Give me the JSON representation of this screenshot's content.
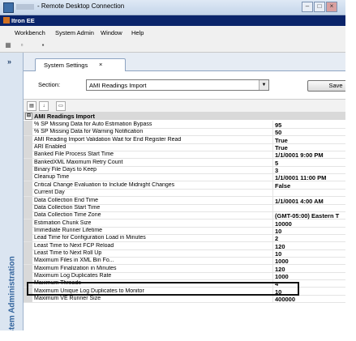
{
  "window": {
    "title": "- Remote Desktop Connection",
    "app_title": "Itron EE"
  },
  "menu": [
    "Workbench",
    "System Admin",
    "Window",
    "Help"
  ],
  "left_panel": {
    "expand_glyph": "»",
    "label": "System Administration"
  },
  "tab": {
    "label": "System Settings",
    "close": "×"
  },
  "section": {
    "label": "Section:",
    "value": "AMI Readings Import",
    "save_label": "Save"
  },
  "category": {
    "toggle": "⊟",
    "name": "AMI Readings Import"
  },
  "rows": [
    {
      "name": "% SP Missing Data for Auto Estimation Bypass",
      "value": "95"
    },
    {
      "name": "% SP Missing Data for Warning Notification",
      "value": "50"
    },
    {
      "name": "AMI Reading Import Validation Wait for End Register Read",
      "value": "True"
    },
    {
      "name": "ARI Enabled",
      "value": "True"
    },
    {
      "name": "Banked File Process Start Time",
      "value": "1/1/0001 9:00 PM"
    },
    {
      "name": "BankedXML Maximum Retry Count",
      "value": "5"
    },
    {
      "name": "Binary File Days to Keep",
      "value": "3"
    },
    {
      "name": "Cleanup Time",
      "value": "1/1/0001 11:00 PM"
    },
    {
      "name": "Critical Change Evaluation to Include Midnight Changes",
      "value": "False"
    },
    {
      "name": "Current Day",
      "value": ""
    },
    {
      "name": "Data Collection End Time",
      "value": "1/1/0001 4:00 AM"
    },
    {
      "name": "Data Collection Start Time",
      "value": ""
    },
    {
      "name": "Data Collection Time Zone",
      "value": "(GMT-05:00) Eastern T"
    },
    {
      "name": "Estimation Chunk Size",
      "value": "10000"
    },
    {
      "name": "Immediate Runner Lifetime",
      "value": "10"
    },
    {
      "name": "Lead Time for Configuration Load in Minutes",
      "value": "2"
    },
    {
      "name": "Least Time to Next FCP Reload",
      "value": "120"
    },
    {
      "name": "Least Time to Next Roll Up",
      "value": "10"
    },
    {
      "name": "Maximum Files in XML Bin Fo...",
      "value": "1000"
    },
    {
      "name": "Maximum Finalization in Minutes",
      "value": "120"
    },
    {
      "name": "Maximum Log Duplicates Rate",
      "value": "1000"
    },
    {
      "name": "Maximum Threads",
      "value": "4"
    },
    {
      "name": "Maximum Unique Log Duplicates to Monitor",
      "value": "10"
    },
    {
      "name": "Maximum VE Runner Size",
      "value": "400000"
    }
  ],
  "icons": {
    "app": "app-icon",
    "categorized": "categorized-icon",
    "alphabetical": "alphabetical-icon",
    "property_pages": "property-pages-icon"
  }
}
